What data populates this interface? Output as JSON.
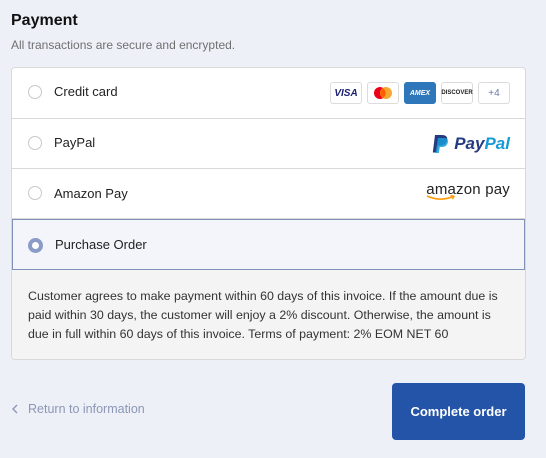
{
  "header": {
    "title": "Payment",
    "subtitle": "All transactions are secure and encrypted."
  },
  "methods": [
    {
      "label": "Credit card",
      "selected": false
    },
    {
      "label": "PayPal",
      "selected": false
    },
    {
      "label": "Amazon Pay",
      "selected": false
    },
    {
      "label": "Purchase Order",
      "selected": true
    }
  ],
  "card_brands": {
    "visa": "VISA",
    "amex": "AMEX",
    "discover": "DISCOVER",
    "more": "+4"
  },
  "logos": {
    "paypal_part1": "Pay",
    "paypal_part2": "Pal",
    "amazon": "amazon pay"
  },
  "purchase_order_description": "Customer agrees to make payment within 60 days of this invoice. If the amount due is paid within 30 days, the customer will enjoy a 2% discount. Otherwise, the amount is due in full within 60 days of this invoice. Terms of payment: 2% EOM NET 60",
  "footer": {
    "back_label": "Return to information",
    "complete_label": "Complete order"
  },
  "colors": {
    "accent": "#2454a8",
    "selected_border": "#8190b6",
    "link": "#8c97b5"
  }
}
